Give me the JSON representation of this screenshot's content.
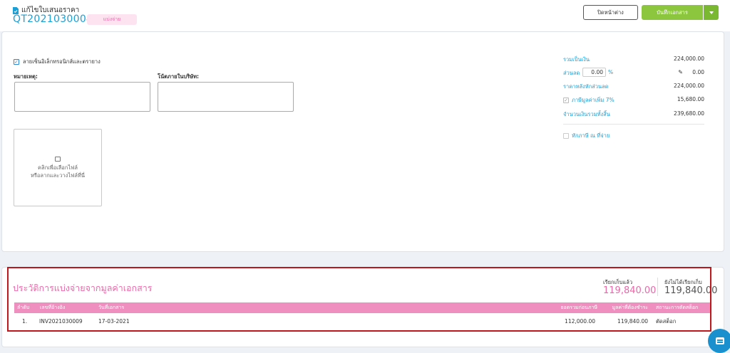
{
  "header": {
    "page_title": "แก้ไขใบเสนอราคา",
    "doc_number": "QT2021030004",
    "badge": "แบ่งจ่าย",
    "close_label": "ปิดหน้าต่าง",
    "save_label": "บันทึกเอกสาร"
  },
  "form": {
    "esign_label": "ลายเซ็นอิเล็กทรอนิกส์และตรายาง",
    "remark_label": "หมายเหตุ:",
    "internal_note_label": "โน้ตภายในบริษัท:",
    "upload_line1": "คลิกเพื่อเลือกไฟล์",
    "upload_line2": "หรือลากและวางไฟล์ที่นี่"
  },
  "summary": {
    "total_label": "รวมเป็นเงิน",
    "total_value": "224,000.00",
    "discount_label": "ส่วนลด",
    "discount_pct": "0.00",
    "pct_symbol": "%",
    "discount_value": "0.00",
    "after_discount_label": "ราคาหลังหักส่วนลด",
    "after_discount_value": "224,000.00",
    "vat_label": "ภาษีมูลค่าเพิ่ม 7%",
    "vat_value": "15,680.00",
    "grand_total_label": "จำนวนเงินรวมทั้งสิ้น",
    "grand_total_value": "239,680.00",
    "wht_label": "หักภาษี ณ ที่จ่าย"
  },
  "history": {
    "title": "ประวัติการแบ่งจ่ายจากมูลค่าเอกสาร",
    "collected_label": "เรียกเก็บแล้ว",
    "collected_value": "119,840.00",
    "uncollected_label": "ยังไม่ได้เรียกเก็บ",
    "uncollected_value": "119,840.00",
    "columns": [
      "ลำดับ",
      "เลขที่อ้างอิง",
      "วันที่เอกสาร",
      "ยอดรวมก่อนภาษี",
      "มูลค่าที่ต้องชำระ",
      "สถานะการตัดสต็อก"
    ],
    "rows": [
      [
        "1.",
        "INV2021030009",
        "17-03-2021",
        "112,000.00",
        "119,840.00",
        "ตัดสต็อก"
      ]
    ]
  },
  "colors": {
    "accent_blue": "#1a9fd6",
    "save_green": "#8cc63f",
    "pink": "#e86aa8",
    "table_header_pink": "#ef8fc0",
    "highlight_red": "#c0171c"
  }
}
